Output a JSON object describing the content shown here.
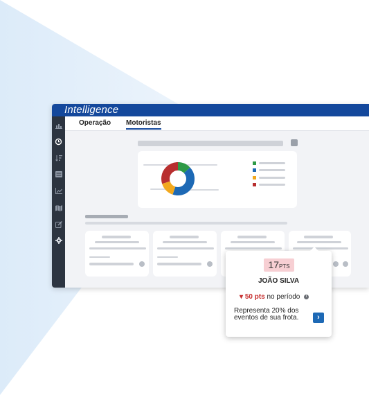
{
  "app": {
    "brand": "Intelligence",
    "accent": "#14489c",
    "sidebar_icons": [
      "bar-chart-icon",
      "history-icon",
      "sort-icon",
      "list-icon",
      "line-chart-icon",
      "map-icon",
      "edit-icon",
      "settings-icon"
    ]
  },
  "tabs": [
    {
      "label": "Operação",
      "active": false
    },
    {
      "label": "Motoristas",
      "active": true
    }
  ],
  "donut": {
    "colors": [
      "#2e9a46",
      "#1d69b5",
      "#f2a81d",
      "#b82f2f"
    ],
    "values": [
      0.13,
      0.42,
      0.15,
      0.3
    ]
  },
  "popup": {
    "points": "17",
    "points_unit": "PTS",
    "driver_name": "JOÃO SILVA",
    "delta_value": "50 pts",
    "delta_suffix": "no período",
    "description": "Representa 20% dos eventos de sua frota.",
    "negative_color": "#c62d2d"
  }
}
